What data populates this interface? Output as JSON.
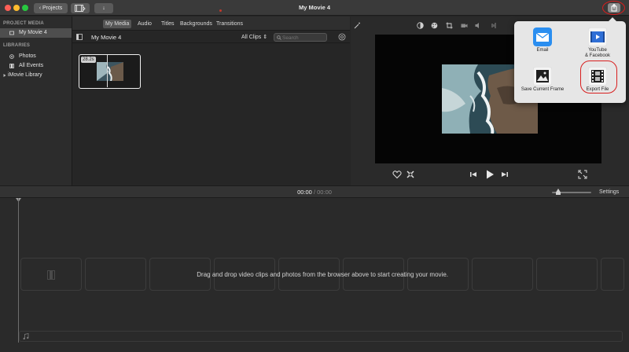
{
  "window": {
    "title": "My Movie 4"
  },
  "toolbar": {
    "projects_label": "Projects"
  },
  "sidebar": {
    "project_media_header": "PROJECT MEDIA",
    "project_item": "My Movie 4",
    "libraries_header": "LIBRARIES",
    "items": [
      {
        "label": "Photos",
        "icon": "photos-icon"
      },
      {
        "label": "All Events",
        "icon": "film-icon"
      },
      {
        "label": "iMovie Library",
        "icon": "disclosure-icon"
      }
    ]
  },
  "browser": {
    "tabs": [
      "My Media",
      "Audio",
      "Titles",
      "Backgrounds",
      "Transitions"
    ],
    "title": "My Movie 4",
    "filter_label": "All Clips",
    "search_placeholder": "Search",
    "clip_duration": "28.2s"
  },
  "share_popover": {
    "items": [
      {
        "label": "Email",
        "icon": "mail-icon"
      },
      {
        "label": "YouTube\n& Facebook",
        "icon": "youtube-facebook-icon"
      },
      {
        "label": "Save Current Frame",
        "icon": "image-icon"
      },
      {
        "label": "Export File",
        "icon": "film-export-icon"
      }
    ]
  },
  "timeline": {
    "current_time": "00:00",
    "separator": "/",
    "total_time": "00:00",
    "settings_label": "Settings",
    "drop_message": "Drag and drop video clips and photos from the browser above to start creating your movie."
  },
  "colors": {
    "accent_red": "#d81e1e",
    "popover_bg": "#e6e6e6",
    "mail_blue": "#2a8ef0"
  }
}
